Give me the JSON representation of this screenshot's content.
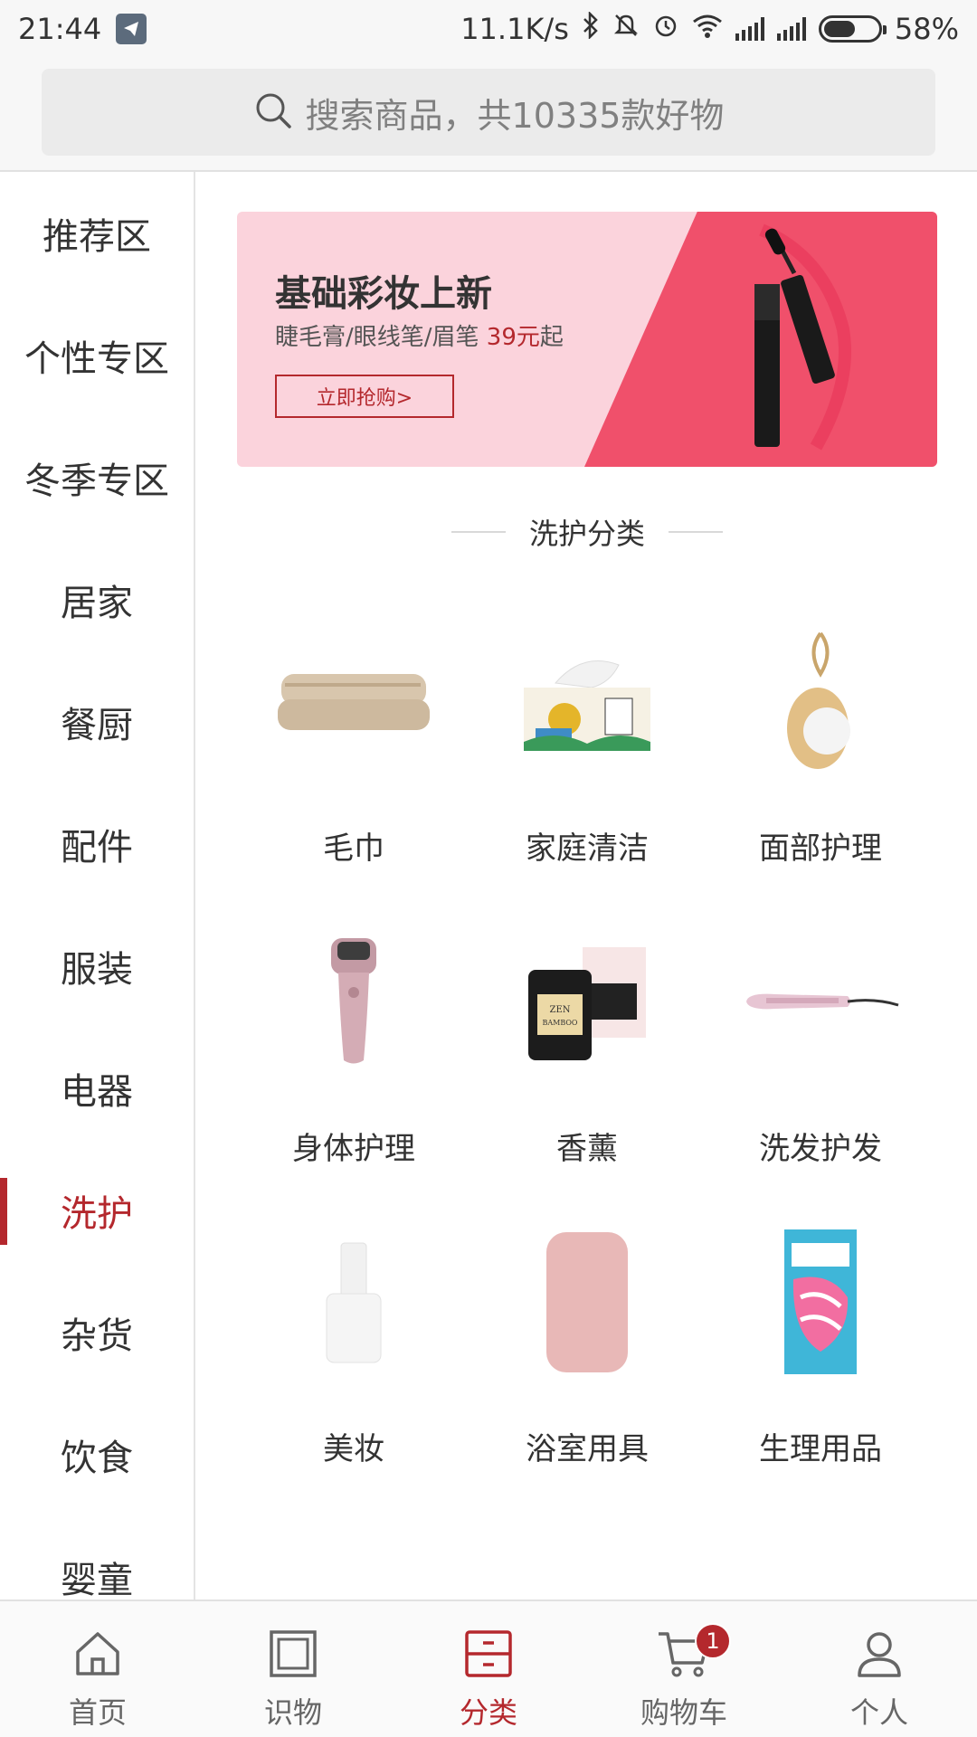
{
  "status_bar": {
    "time": "21:44",
    "speed": "11.1K/s",
    "battery": "58%",
    "battery_level": 0.58
  },
  "search": {
    "placeholder": "搜索商品，共10335款好物"
  },
  "sidebar": {
    "items": [
      {
        "label": "推荐区"
      },
      {
        "label": "个性专区"
      },
      {
        "label": "冬季专区"
      },
      {
        "label": "居家"
      },
      {
        "label": "餐厨"
      },
      {
        "label": "配件"
      },
      {
        "label": "服装"
      },
      {
        "label": "电器"
      },
      {
        "label": "洗护",
        "active": true
      },
      {
        "label": "杂货"
      },
      {
        "label": "饮食"
      },
      {
        "label": "婴童"
      }
    ]
  },
  "banner": {
    "title": "基础彩妆上新",
    "subtitle": "睫毛膏/眼线笔/眉笔",
    "price": "39元",
    "price_suffix": "起",
    "button": "立即抢购>"
  },
  "section": {
    "title": "洗护分类"
  },
  "categories": [
    {
      "label": "毛巾",
      "icon": "towel-icon"
    },
    {
      "label": "家庭清洁",
      "icon": "tissue-box-icon"
    },
    {
      "label": "面部护理",
      "icon": "face-brush-icon"
    },
    {
      "label": "身体护理",
      "icon": "body-roller-icon"
    },
    {
      "label": "香薰",
      "icon": "candle-icon"
    },
    {
      "label": "洗发护发",
      "icon": "hair-straightener-icon"
    },
    {
      "label": "美妆",
      "icon": "nail-polish-icon"
    },
    {
      "label": "浴室用具",
      "icon": "bath-mat-icon"
    },
    {
      "label": "生理用品",
      "icon": "condom-box-icon"
    }
  ],
  "tabbar": {
    "items": [
      {
        "label": "首页",
        "icon": "home-icon"
      },
      {
        "label": "识物",
        "icon": "square-icon"
      },
      {
        "label": "分类",
        "icon": "category-icon",
        "active": true
      },
      {
        "label": "购物车",
        "icon": "cart-icon",
        "badge": "1"
      },
      {
        "label": "个人",
        "icon": "person-icon"
      }
    ]
  },
  "colors": {
    "accent": "#b4282d",
    "banner_bg": "#fbd3dc",
    "banner_accent": "#f0506b"
  }
}
